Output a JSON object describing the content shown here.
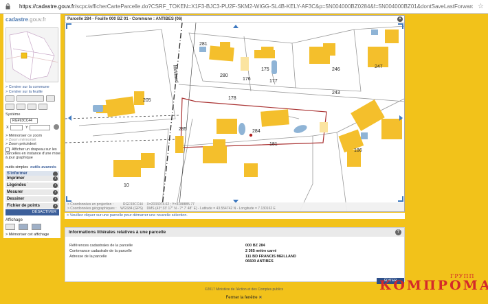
{
  "browser": {
    "url_host": "https://cadastre.gouv.fr",
    "url_rest": "/scpc/afficherCarteParcelle.do?CSRF_TOKEN=X1F3-BJC3-PU2F-SKM2-WIGG-SL4B-KELY-AF3C&p=5N004000BZ0284&f=5N004000BZ01&dontSaveLastForward&keepVolatileSes"
  },
  "sidebar": {
    "logo_main": "cadastre",
    "logo_suffix": ".gouv.fr",
    "center_commune": "> Centrer sur la commune",
    "center_feuille": "> Centrer sur la feuille",
    "systeme_label": "Système",
    "systeme_value": "RGF93CC44",
    "x_label": "X",
    "y_label": "Y",
    "memorize": "> Mémoriser ce zoom",
    "zoom_memo": "> Zoom mémorisé",
    "zoom_prev": "> Zoom précédent",
    "flag_text_1": "Afficher un drapeau sur les",
    "flag_text_2": "parcelles en instance d'une mise",
    "flag_text_3": "à jour graphique",
    "tab_simple": "outils simples",
    "tab_advanced": "outils avancés",
    "informer": "S'informer",
    "menu": [
      "Imprimer",
      "Légendes",
      "Mesurer",
      "Dessiner",
      "Fichier de points"
    ],
    "deactivate": "DÉSACTIVER",
    "affichage": "Affichage",
    "memorize_display": "> Mémoriser cet affichage"
  },
  "map": {
    "header": "Parcelle 284 - Feuille 000 BZ 01 - Commune : ANTIBES (06)",
    "street": "Meilland",
    "parcel_labels": [
      "281",
      "280",
      "175",
      "176",
      "177",
      "246",
      "247",
      "178",
      "243",
      "205",
      "285",
      "284",
      "181",
      "186",
      "10"
    ],
    "coord_line1_label": "> Coordonnées en projection :",
    "coord_line1_sys": "RGF93CC44",
    "coord_line1_val": "X=2033074.62 ; Y=3188885.77",
    "coord_line2_label": "> Coordonnées géographiques :",
    "coord_line2_sys": "WGS84 (GPS)",
    "coord_line2_val": "DMS (43° 33' 17'' N - 7° 7' 48'' E) - Latitude = 43.554742 N - Longitude = 7.130162 E",
    "hint": "> Veuillez cliquer sur une parcelle pour démarrer une nouvelle sélection."
  },
  "info": {
    "title": "Informations littérales relatives à une parcelle",
    "rows": [
      {
        "label": "Références cadastrales de la parcelle",
        "value": "000 BZ 284"
      },
      {
        "label": "Contenance cadastrale de la parcelle",
        "value": "2 365 mètre carré"
      },
      {
        "label": "Adresse de la parcelle",
        "value": "111 BD FRANCIS MEILLAND"
      }
    ],
    "city": "06600 ANTIBES"
  },
  "editor_btn": "ÉDITER",
  "brand_top": "ГРУПП",
  "brand_main": "КОМПРОМАТ",
  "footer": "©2017 Ministère de l'Action et des Comptes publics",
  "close_window": "Fermer la fenêtre"
}
